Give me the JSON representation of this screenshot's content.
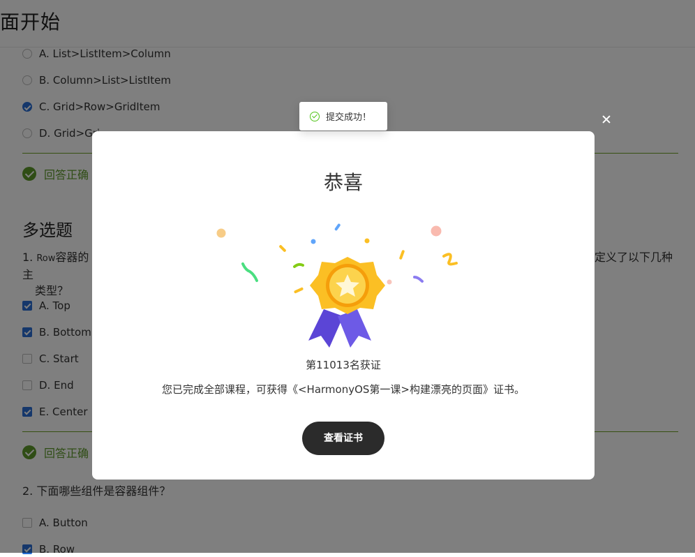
{
  "page": {
    "title": "面开始"
  },
  "single_choice": {
    "options": [
      {
        "label": "A. List>ListItem>Column",
        "checked": false
      },
      {
        "label": "B. Column>List>ListItem",
        "checked": false
      },
      {
        "label": "C. Grid>Row>GridItem",
        "checked": true
      },
      {
        "label": "D. Grid>Gri",
        "checked": false
      }
    ],
    "result": "回答正确"
  },
  "multi_choice": {
    "section_title": "多选题",
    "q1": {
      "num": "1. ",
      "prefix_small": "Row",
      "prefix_text": "容器的主",
      "line2": "类型？",
      "right_text": "定义了以下几种",
      "options": [
        {
          "label": "A. Top",
          "checked": true
        },
        {
          "label": "B. Bottom",
          "checked": true
        },
        {
          "label": "C. Start",
          "checked": false
        },
        {
          "label": "D. End",
          "checked": false
        },
        {
          "label": "E. Center",
          "checked": true
        }
      ],
      "result": "回答正确"
    },
    "q2": {
      "text": "2. 下面哪些组件是容器组件？",
      "options": [
        {
          "label": "A. Button",
          "checked": false
        },
        {
          "label": "B. Row",
          "checked": true
        }
      ]
    }
  },
  "toast": {
    "text": "提交成功！"
  },
  "modal": {
    "title": "恭喜",
    "rank": "第11013名获证",
    "description": "您已完成全部课程，可获得《<HarmonyOS第一课>构建漂亮的页面》证书。",
    "button_label": "查看证书"
  },
  "colors": {
    "accent": "#2a6fd6",
    "success_green": "#5f9a2b",
    "button_dark": "#2b2b2b",
    "medal_gold": "#fbbf24",
    "ribbon_purple": "#5b45d6"
  }
}
